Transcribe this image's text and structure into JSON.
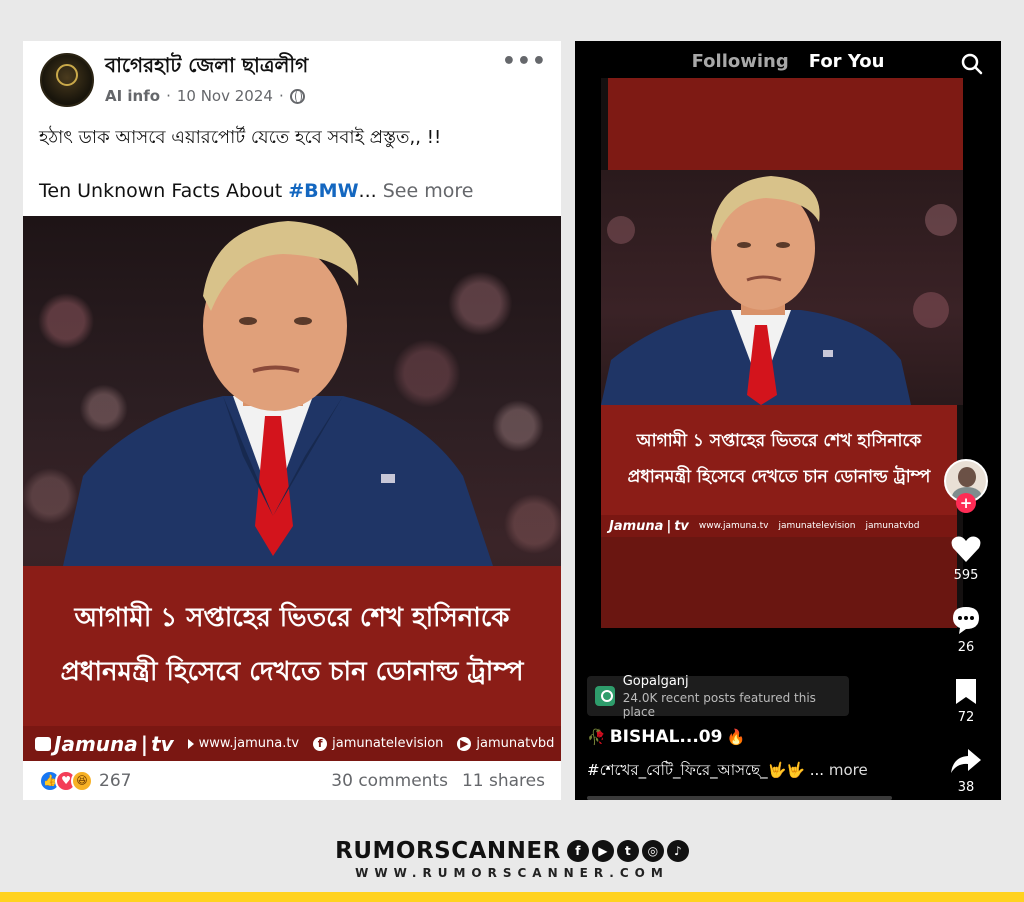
{
  "facebook": {
    "page_name": "বাগেরহাট জেলা ছাত্রলীগ",
    "ai_info": "AI info",
    "separator": "·",
    "date": "10 Nov 2024",
    "more_dots": "•••",
    "post_line1": "হঠাৎ ডাক আসবে এয়ারপোর্ট যেতে হবে সবাই প্রস্তুত,, !!",
    "post_line2_prefix": "Ten Unknown Facts About ",
    "post_hashtag": "#BMW",
    "post_ellipsis": "...",
    "see_more": "See more",
    "banner_line1": "আগামী ১ সপ্তাহের ভিতরে শেখ হাসিনাকে",
    "banner_line2": "প্রধানমন্ত্রী হিসেবে দেখতে চান ডোনাল্ড ট্রাম্প",
    "brand_name": "Jamuna",
    "brand_tv": "tv",
    "brand_web": "www.jamuna.tv",
    "brand_fb": "jamunatelevision",
    "brand_yt": "jamunatvbd",
    "reaction_count": "267",
    "comments": "30 comments",
    "shares": "11 shares"
  },
  "tiktok": {
    "tab_following": "Following",
    "tab_for_you": "For You",
    "banner_line1": "আগামী ১ সপ্তাহের ভিতরে শেখ হাসিনাকে",
    "banner_line2": "প্রধানমন্ত্রী হিসেবে দেখতে চান ডোনাল্ড ট্রাম্প",
    "brand_name": "Jamuna",
    "brand_tv": "tv",
    "brand_web": "www.jamuna.tv",
    "brand_fb": "jamunatelevision",
    "brand_yt": "jamunatvbd",
    "likes": "595",
    "comments": "26",
    "saves": "72",
    "shares": "38",
    "location_name": "Gopalganj",
    "location_sub": "24.0K recent posts featured this place",
    "username": "BISHAL...09",
    "caption": "#শেখের_বেটি_ফিরে_আসছে_🤟🤟 ...",
    "more": "more"
  },
  "footer": {
    "brand": "RUMORSCANNER",
    "url": "WWW.RUMORSCANNER.COM",
    "accent_color": "#ffd21f"
  },
  "icons": [
    "globe-icon",
    "search-icon",
    "heart-icon",
    "comment-icon",
    "bookmark-icon",
    "share-icon",
    "location-pin-icon",
    "plus-icon"
  ]
}
